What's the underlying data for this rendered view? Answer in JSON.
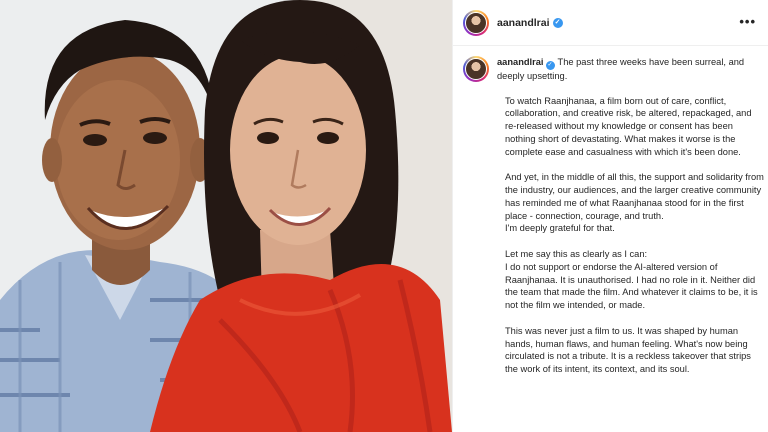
{
  "post": {
    "username": "aanandlrai",
    "menu_icon": "more-horizontal-icon",
    "verified_icon": "verified-badge-icon",
    "first_line": "The past three weeks have been surreal, and deeply upsetting.",
    "paragraphs": [
      "To watch Raanjhanaa, a film born out of care, conflict, collaboration, and creative risk, be altered, repackaged, and re-released without my knowledge or consent has been nothing short of devastating. What makes it worse is the complete ease and casualness with which it's been done.",
      "And yet, in the middle of all this, the support and solidarity from the industry, our audiences, and the larger creative community has reminded me of what Raanjhanaa stood for in the first place - connection, courage, and truth.\nI'm deeply grateful for that.",
      "Let me say this as clearly as I can:\nI do not support or endorse the AI-altered version of Raanjhanaa. It is unauthorised. I had no role in it. Neither did the team that made the film. And whatever it claims to be, it is not the film we intended, or made.",
      "This was never just a film to us. It was shaped by human hands, human flaws, and human feeling. What's now being circulated is not a tribute. It is a reckless takeover that strips the work of its intent, its context, and its soul."
    ]
  },
  "colors": {
    "verified": "#3897f0",
    "text": "#262626",
    "dupatta": "#d8321e"
  }
}
